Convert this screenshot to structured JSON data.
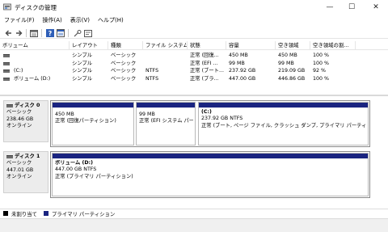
{
  "window": {
    "title": "ディスクの管理",
    "minimize": "—",
    "maximize": "☐",
    "close": "✕"
  },
  "menu": [
    "ファイル(F)",
    "操作(A)",
    "表示(V)",
    "ヘルプ(H)"
  ],
  "toolbar_icons": [
    "back-arrow-icon",
    "forward-arrow-icon",
    "volume-list-icon",
    "help-icon",
    "properties-icon",
    "connect-icon",
    "settings-icon"
  ],
  "volume_list": {
    "columns": [
      "ボリューム",
      "レイアウト",
      "種類",
      "ファイル システム",
      "状態",
      "容量",
      "空き領域",
      "空き領域の割..."
    ],
    "rows": [
      {
        "volume": "",
        "layout": "シンプル",
        "type": "ベーシック",
        "fs": "",
        "status": "正常 (回復...",
        "capacity": "450 MB",
        "free": "450 MB",
        "pct": "100 %"
      },
      {
        "volume": "",
        "layout": "シンプル",
        "type": "ベーシック",
        "fs": "",
        "status": "正常 (EFI ...",
        "capacity": "99 MB",
        "free": "99 MB",
        "pct": "100 %"
      },
      {
        "volume": "(C:)",
        "layout": "シンプル",
        "type": "ベーシック",
        "fs": "NTFS",
        "status": "正常 (ブート...",
        "capacity": "237.92 GB",
        "free": "219.09 GB",
        "pct": "92 %"
      },
      {
        "volume": "ボリューム (D:)",
        "layout": "シンプル",
        "type": "ベーシック",
        "fs": "NTFS",
        "status": "正常 (プラ...",
        "capacity": "447.00 GB",
        "free": "446.86 GB",
        "pct": "100 %"
      }
    ]
  },
  "disks": [
    {
      "name": "ディスク 0",
      "kind": "ベーシック",
      "size": "238.46 GB",
      "state": "オンライン",
      "partitions": [
        {
          "name": "",
          "size": "450 MB",
          "status": "正常 (回復パーティション)"
        },
        {
          "name": "",
          "size": "99 MB",
          "status": "正常 (EFI システム パー"
        },
        {
          "name": "(C:)",
          "size": "237.92 GB NTFS",
          "status": "正常 (ブート, ページ ファイル, クラッシュ ダンプ, プライマリ パーティション"
        }
      ]
    },
    {
      "name": "ディスク 1",
      "kind": "ベーシック",
      "size": "447.01 GB",
      "state": "オンライン",
      "partitions": [
        {
          "name": "ボリューム (D:)",
          "size": "447.00 GB NTFS",
          "status": "正常 (プライマリ パーティション)"
        }
      ]
    }
  ],
  "legend": [
    {
      "label": "未割り当て",
      "color": "#000000"
    },
    {
      "label": "プライマリ パーティション",
      "color": "#1a2480"
    }
  ],
  "colors": {
    "partition_bar": "#1a2480",
    "unallocated": "#000000"
  }
}
